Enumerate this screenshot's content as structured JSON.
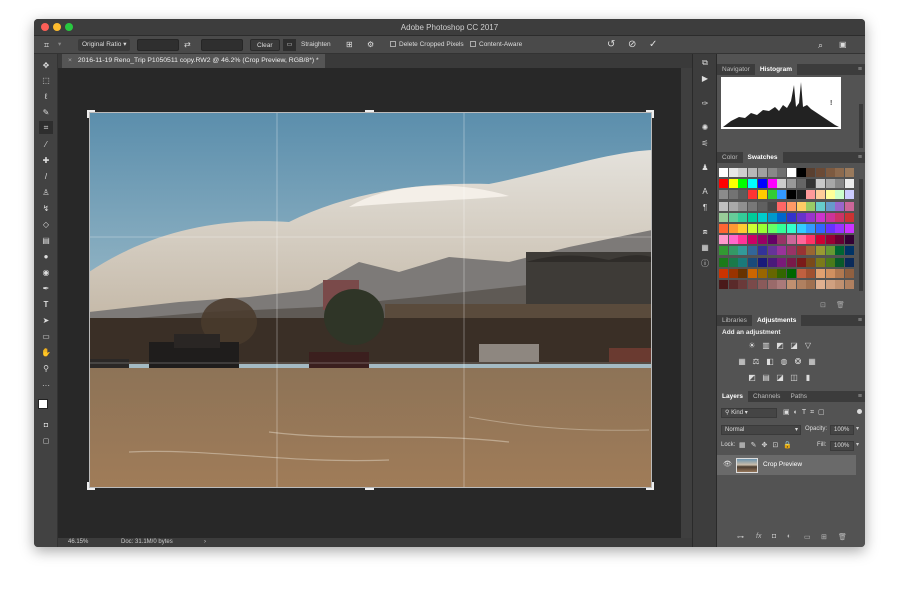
{
  "app": {
    "title": "Adobe Photoshop CC 2017"
  },
  "options_bar": {
    "ratio_label": "Original Ratio",
    "clear_label": "Clear",
    "straighten_label": "Straighten",
    "delete_cropped_label": "Delete Cropped Pixels",
    "content_aware_label": "Content-Aware"
  },
  "document": {
    "tab_title": "2016-11-19 Reno_Trip P1050511 copy.RW2 @ 46.2% (Crop Preview, RGB/8*) *"
  },
  "status": {
    "zoom": "46.15%",
    "doc_info": "Doc: 31.1M/0 bytes",
    "arrow": "›"
  },
  "panels": {
    "navigator_tab": "Navigator",
    "histogram_tab": "Histogram",
    "warning_icon": "!",
    "color_tab": "Color",
    "swatches_tab": "Swatches",
    "libraries_tab": "Libraries",
    "adjustments_tab": "Adjustments",
    "add_adjustment": "Add an adjustment",
    "layers_tab": "Layers",
    "channels_tab": "Channels",
    "paths_tab": "Paths",
    "kind_filter": "Kind",
    "blend_mode": "Normal",
    "opacity_label": "Opacity:",
    "opacity_value": "100%",
    "lock_label": "Lock:",
    "fill_label": "Fill:",
    "fill_value": "100%",
    "layer_name": "Crop Preview"
  },
  "colors": {
    "accent": "#4a90d9",
    "panel_bg": "#535353",
    "canvas_bg": "#282828"
  }
}
